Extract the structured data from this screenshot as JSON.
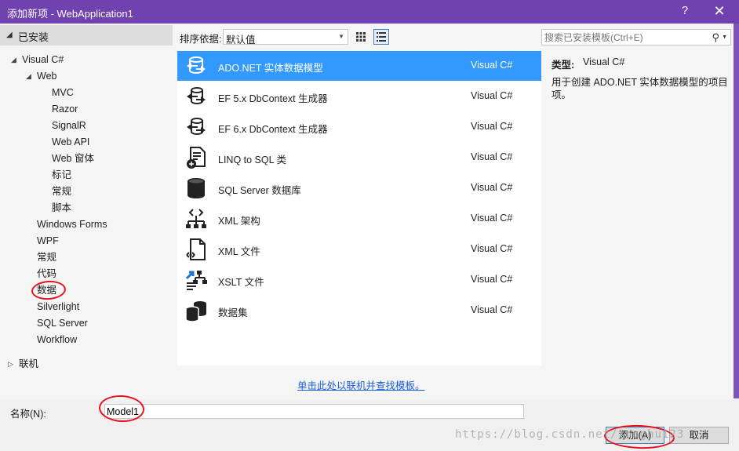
{
  "window": {
    "title": "添加新项 - WebApplication1",
    "help": "?",
    "close": "✕",
    "accent": "#6f42b0"
  },
  "left_pane": {
    "installed_label": "已安装",
    "tree": [
      {
        "label": "Visual C#",
        "expander": "◢"
      },
      {
        "label": "Web",
        "expander": "◢"
      },
      {
        "label": "MVC"
      },
      {
        "label": "Razor"
      },
      {
        "label": "SignalR"
      },
      {
        "label": "Web API"
      },
      {
        "label": "Web 窗体"
      },
      {
        "label": "标记"
      },
      {
        "label": "常规"
      },
      {
        "label": "脚本"
      },
      {
        "label": "Windows Forms"
      },
      {
        "label": "WPF"
      },
      {
        "label": "常规"
      },
      {
        "label": "代码"
      },
      {
        "label": "数据"
      },
      {
        "label": "Silverlight"
      },
      {
        "label": "SQL Server"
      },
      {
        "label": "Workflow"
      },
      {
        "label": "联机",
        "expander": "▷"
      }
    ]
  },
  "toolbar": {
    "sort_label": "排序依据:",
    "sort_value": "默认值",
    "view_grid_icon": "grid-view-icon",
    "view_list_icon": "list-view-icon"
  },
  "search": {
    "placeholder": "搜索已安装模板(Ctrl+E)",
    "icon": "search-icon"
  },
  "templates": [
    {
      "name": "ADO.NET 实体数据模型",
      "lang": "Visual C#",
      "icon": "entity-model-icon",
      "selected": true
    },
    {
      "name": "EF 5.x DbContext 生成器",
      "lang": "Visual C#",
      "icon": "dbcontext-generator-icon"
    },
    {
      "name": "EF 6.x DbContext 生成器",
      "lang": "Visual C#",
      "icon": "dbcontext-generator-icon"
    },
    {
      "name": "LINQ to SQL 类",
      "lang": "Visual C#",
      "icon": "linq-to-sql-icon"
    },
    {
      "name": "SQL Server 数据库",
      "lang": "Visual C#",
      "icon": "database-icon"
    },
    {
      "name": "XML 架构",
      "lang": "Visual C#",
      "icon": "xml-schema-icon"
    },
    {
      "name": "XML 文件",
      "lang": "Visual C#",
      "icon": "xml-file-icon"
    },
    {
      "name": "XSLT 文件",
      "lang": "Visual C#",
      "icon": "xslt-file-icon"
    },
    {
      "name": "数据集",
      "lang": "Visual C#",
      "icon": "dataset-icon"
    }
  ],
  "details": {
    "type_label": "类型:",
    "type_value": "Visual C#",
    "description": "用于创建 ADO.NET 实体数据模型的项目项。"
  },
  "online_link": "单击此处以联机并查找模板。",
  "name_field": {
    "label": "名称(N):",
    "value": "Model1"
  },
  "buttons": {
    "add": "添加(A)",
    "cancel": "取消"
  },
  "watermark": "https://blog.csdn.net/tonghu123"
}
